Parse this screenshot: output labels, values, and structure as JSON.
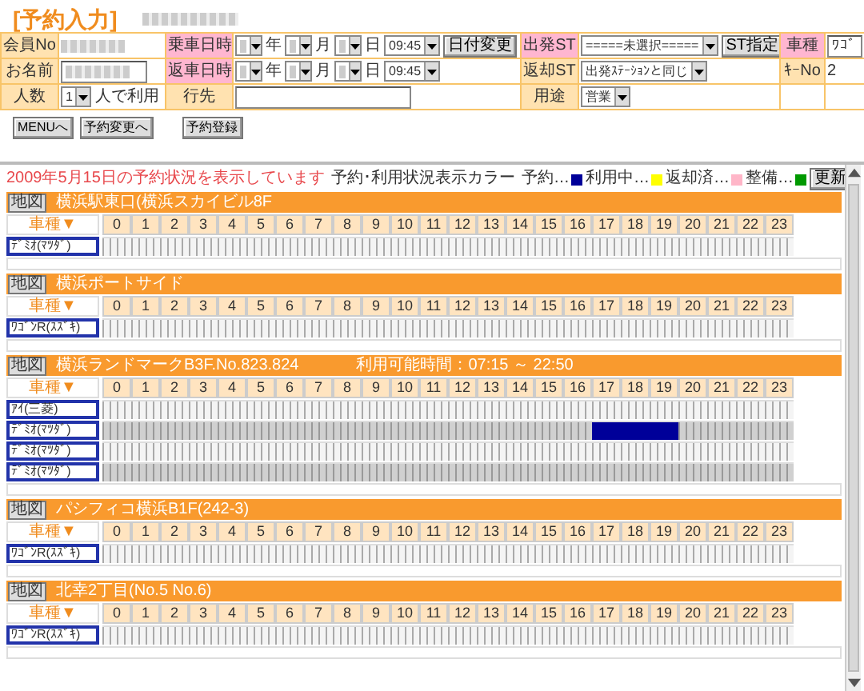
{
  "title": "[予約入力]",
  "form": {
    "rows": [
      {
        "cells": [
          {
            "kind": "label",
            "text": "会員No",
            "highlight": false
          },
          {
            "kind": "controls",
            "items": [
              {
                "kind": "redacted"
              }
            ]
          },
          {
            "kind": "label",
            "text": "乗車日時",
            "highlight": true
          },
          {
            "kind": "controls",
            "items": [
              {
                "kind": "redacted_select"
              },
              {
                "kind": "text",
                "text": "年"
              },
              {
                "kind": "redacted_select"
              },
              {
                "kind": "text",
                "text": "月"
              },
              {
                "kind": "redacted_select"
              },
              {
                "kind": "text",
                "text": "日"
              },
              {
                "kind": "select",
                "value": "09:45"
              },
              {
                "kind": "button",
                "text": "日付変更"
              }
            ]
          },
          {
            "kind": "label",
            "text": "出発ST",
            "highlight": true
          },
          {
            "kind": "controls",
            "items": [
              {
                "kind": "select",
                "value": "=====未選択====="
              },
              {
                "kind": "button",
                "text": "ST指定"
              }
            ]
          },
          {
            "kind": "label",
            "text": "車種",
            "highlight": true
          },
          {
            "kind": "controls",
            "items": [
              {
                "kind": "input",
                "value": "ﾜｺﾞ"
              }
            ]
          }
        ]
      },
      {
        "cells": [
          {
            "kind": "label",
            "text": "お名前",
            "highlight": false
          },
          {
            "kind": "controls",
            "items": [
              {
                "kind": "redacted_input"
              }
            ]
          },
          {
            "kind": "label",
            "text": "返車日時",
            "highlight": true
          },
          {
            "kind": "controls",
            "items": [
              {
                "kind": "redacted_select"
              },
              {
                "kind": "text",
                "text": "年"
              },
              {
                "kind": "redacted_select"
              },
              {
                "kind": "text",
                "text": "月"
              },
              {
                "kind": "redacted_select"
              },
              {
                "kind": "text",
                "text": "日"
              },
              {
                "kind": "select",
                "value": "09:45"
              }
            ]
          },
          {
            "kind": "label",
            "text": "返却ST",
            "highlight": false
          },
          {
            "kind": "controls",
            "items": [
              {
                "kind": "select",
                "value": "出発ｽﾃｰｼｮﾝと同じ"
              }
            ]
          },
          {
            "kind": "label",
            "text": "ｷｰNo",
            "highlight": false
          },
          {
            "kind": "controls",
            "items": [
              {
                "kind": "text",
                "text": "2"
              }
            ]
          }
        ]
      },
      {
        "cells": [
          {
            "kind": "label",
            "text": "人数",
            "highlight": false
          },
          {
            "kind": "controls",
            "items": [
              {
                "kind": "select",
                "value": "1"
              },
              {
                "kind": "text",
                "text": "人で利用"
              }
            ]
          },
          {
            "kind": "label",
            "text": "行先",
            "highlight": false
          },
          {
            "kind": "controls",
            "items": [
              {
                "kind": "input",
                "value": ""
              }
            ]
          },
          {
            "kind": "label",
            "text": "用途",
            "highlight": false
          },
          {
            "kind": "controls",
            "items": [
              {
                "kind": "select",
                "value": "営業"
              }
            ]
          },
          {
            "kind": "empty"
          },
          {
            "kind": "empty"
          }
        ]
      }
    ]
  },
  "buttons": [
    "MENUへ",
    "予約変更へ",
    "予約登録"
  ],
  "status_text": "2009年5月15日の予約状況を表示しています",
  "legend": {
    "title": "予約･利用状況表示カラー",
    "items": [
      {
        "label": "予約…",
        "color": "#000099"
      },
      {
        "label": "利用中…",
        "color": "#ffff00"
      },
      {
        "label": "返却済…",
        "color": "#ffb6c8"
      },
      {
        "label": "整備…",
        "color": "#009900"
      }
    ]
  },
  "refresh_button": "更新",
  "stations": [
    {
      "map_button": "地図",
      "name": "横浜駅東口(横浜スカイビル8F",
      "car_type_header": "車種▼",
      "hours": [
        "0",
        "1",
        "2",
        "3",
        "4",
        "5",
        "6",
        "7",
        "8",
        "9",
        "10",
        "11",
        "12",
        "13",
        "14",
        "15",
        "16",
        "17",
        "18",
        "19",
        "20",
        "21",
        "22",
        "23"
      ],
      "cars": [
        {
          "name": "ﾃﾞﾐｵ(ﾏﾂﾀﾞ)"
        }
      ]
    },
    {
      "map_button": "地図",
      "name": "横浜ポートサイド",
      "car_type_header": "車種▼",
      "hours": [
        "0",
        "1",
        "2",
        "3",
        "4",
        "5",
        "6",
        "7",
        "8",
        "9",
        "10",
        "11",
        "12",
        "13",
        "14",
        "15",
        "16",
        "17",
        "18",
        "19",
        "20",
        "21",
        "22",
        "23"
      ],
      "cars": [
        {
          "name": "ﾜｺﾞﾝR(ｽｽﾞｷ)"
        }
      ]
    },
    {
      "map_button": "地図",
      "name": "横浜ランドマークB3F.No.823.824",
      "info": "利用可能時間：07:15 ～ 22:50",
      "car_type_header": "車種▼",
      "hours": [
        "0",
        "1",
        "2",
        "3",
        "4",
        "5",
        "6",
        "7",
        "8",
        "9",
        "10",
        "11",
        "12",
        "13",
        "14",
        "15",
        "16",
        "17",
        "18",
        "19",
        "20",
        "21",
        "22",
        "23"
      ],
      "cars": [
        {
          "name": "ｱｲ(三菱)"
        },
        {
          "name": "ﾃﾞﾐｵ(ﾏﾂﾀﾞ)",
          "reserved": [
            false,
            false,
            false,
            false,
            false,
            false,
            false,
            false,
            false,
            false,
            false,
            false,
            false,
            false,
            false,
            false,
            false,
            true,
            true,
            true,
            false,
            false,
            false,
            false
          ]
        },
        {
          "name": "ﾃﾞﾐｵ(ﾏﾂﾀﾞ)"
        },
        {
          "name": "ﾃﾞﾐｵ(ﾏﾂﾀﾞ)"
        }
      ]
    },
    {
      "map_button": "地図",
      "name": "パシフィコ横浜B1F(242-3)",
      "car_type_header": "車種▼",
      "hours": [
        "0",
        "1",
        "2",
        "3",
        "4",
        "5",
        "6",
        "7",
        "8",
        "9",
        "10",
        "11",
        "12",
        "13",
        "14",
        "15",
        "16",
        "17",
        "18",
        "19",
        "20",
        "21",
        "22",
        "23"
      ],
      "cars": [
        {
          "name": "ﾜｺﾞﾝR(ｽｽﾞｷ)"
        }
      ]
    },
    {
      "map_button": "地図",
      "name": "北幸2丁目(No.5 No.6)",
      "car_type_header": "車種▼",
      "hours": [
        "0",
        "1",
        "2",
        "3",
        "4",
        "5",
        "6",
        "7",
        "8",
        "9",
        "10",
        "11",
        "12",
        "13",
        "14",
        "15",
        "16",
        "17",
        "18",
        "19",
        "20",
        "21",
        "22",
        "23"
      ],
      "cars": [
        {
          "name": "ﾜｺﾞﾝR(ｽｽﾞｷ)"
        }
      ]
    }
  ]
}
